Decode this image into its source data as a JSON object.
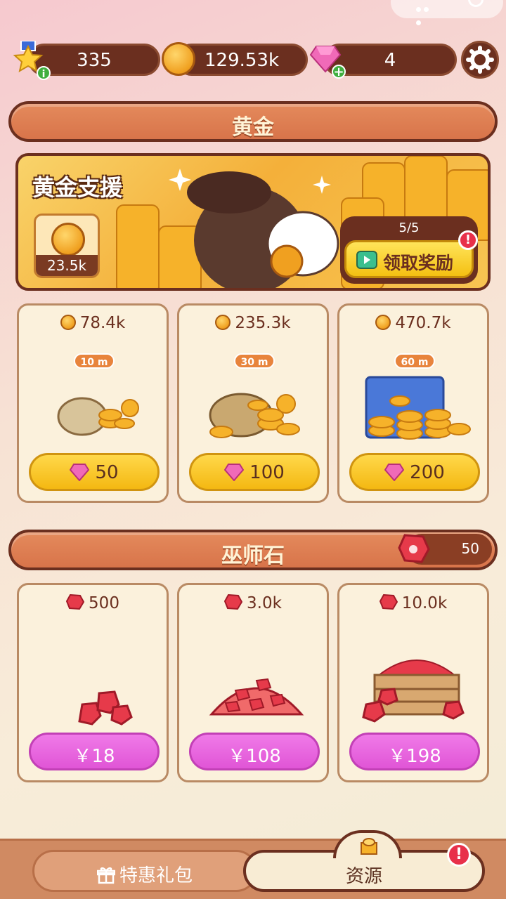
{
  "resources": {
    "stars": "335",
    "gold": "129.53k",
    "gems": "4"
  },
  "gold_section": {
    "title": "黄金",
    "banner": {
      "title": "黄金支援",
      "reward_amount": "23.5k",
      "claim_count": "5/5",
      "claim_label": "领取奖励"
    },
    "packs": [
      {
        "amount": "78.4k",
        "duration": "10 m",
        "cost": "50"
      },
      {
        "amount": "235.3k",
        "duration": "30 m",
        "cost": "100"
      },
      {
        "amount": "470.7k",
        "duration": "60 m",
        "cost": "200"
      }
    ]
  },
  "wizard_section": {
    "title": "巫师石",
    "owned": "50",
    "packs": [
      {
        "amount": "500",
        "price": "￥18"
      },
      {
        "amount": "3.0k",
        "price": "￥108"
      },
      {
        "amount": "10.0k",
        "price": "￥198"
      }
    ]
  },
  "tabs": {
    "left": "特惠礼包",
    "right": "资源"
  },
  "colors": {
    "accent": "#d8744a",
    "gold_button": "#f4c012",
    "pink_button": "#e055d6",
    "dark_brown": "#6b2f1f"
  }
}
